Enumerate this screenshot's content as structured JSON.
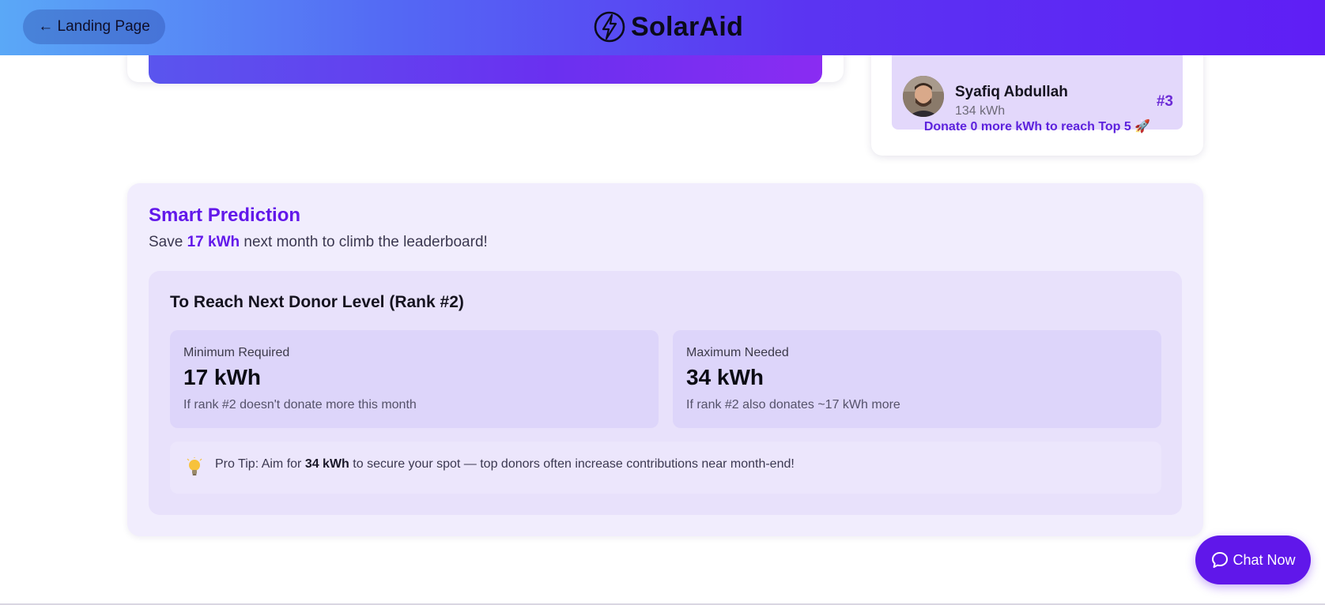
{
  "header": {
    "back_label": "← Landing Page",
    "brand_name": "SolarAid",
    "logo_icon": "bolt-circle-icon"
  },
  "leaderboard": {
    "entry": {
      "name": "Syafiq Abdullah",
      "kwh": "134 kWh",
      "rank": "#3"
    },
    "donate_note": "Donate 0 more kWh to reach Top 5 🚀"
  },
  "prediction": {
    "title": "Smart Prediction",
    "subtitle_prefix": "Save ",
    "subtitle_highlight": "17 kWh",
    "subtitle_suffix": " next month to climb the leaderboard!",
    "next_level_title": "To Reach Next Donor Level (Rank #2)",
    "minimum": {
      "label": "Minimum Required",
      "value": "17 kWh",
      "note": "If rank #2 doesn't donate more this month"
    },
    "maximum": {
      "label": "Maximum Needed",
      "value": "34 kWh",
      "note": "If rank #2 also donates ~17 kWh more"
    },
    "tip": {
      "icon": "lightbulb-icon",
      "prefix": "Pro Tip: Aim for ",
      "bold": "34 kWh",
      "suffix": " to secure your spot — top donors often increase contributions near month-end!"
    }
  },
  "chat": {
    "label": "Chat Now",
    "icon": "chat-bubble-icon"
  },
  "colors": {
    "accent": "#6218ea",
    "panel_bg": "#f1edfd",
    "leader_row_bg": "#e3d8fb"
  }
}
